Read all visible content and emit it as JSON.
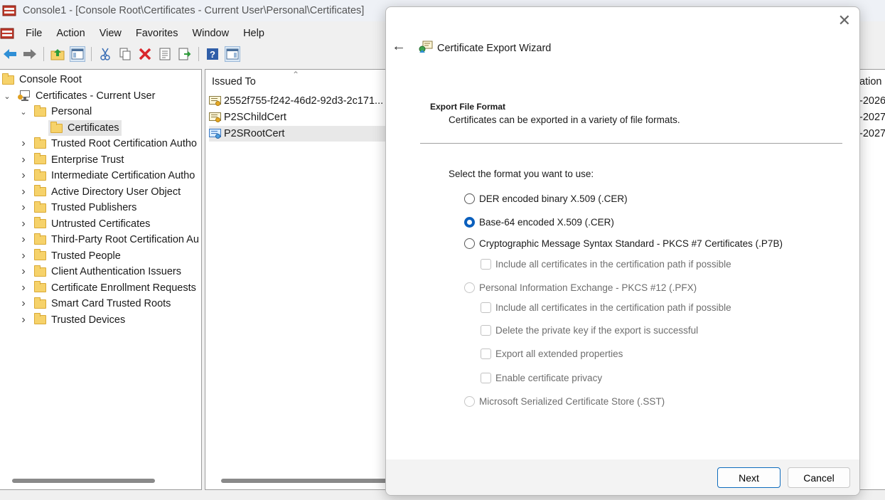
{
  "window": {
    "title": "Console1 - [Console Root\\Certificates - Current User\\Personal\\Certificates]"
  },
  "menu": [
    "File",
    "Action",
    "View",
    "Favorites",
    "Window",
    "Help"
  ],
  "toolbar": {
    "icons": [
      "back-icon",
      "forward-icon",
      "up-folder-icon",
      "show-hide-tree-icon",
      "cut-icon",
      "copy-icon",
      "delete-icon",
      "properties-icon",
      "export-list-icon",
      "help-icon",
      "action-pane-icon"
    ]
  },
  "tree": {
    "root": "Console Root",
    "store": "Certificates - Current User",
    "personal": "Personal",
    "certificates": "Certificates",
    "folders": [
      "Trusted Root Certification Autho",
      "Enterprise Trust",
      "Intermediate Certification Autho",
      "Active Directory User Object",
      "Trusted Publishers",
      "Untrusted Certificates",
      "Third-Party Root Certification Au",
      "Trusted People",
      "Client Authentication Issuers",
      "Certificate Enrollment Requests",
      "Smart Card Trusted Roots",
      "Trusted Devices"
    ]
  },
  "list": {
    "column_issued_to": "Issued To",
    "column_expiration": "ation D",
    "rows": [
      {
        "name": "2552f755-f242-46d2-92d3-2c171...",
        "expiration": "-2026",
        "icon": "certificate-key-icon"
      },
      {
        "name": "P2SChildCert",
        "expiration": "-2027",
        "icon": "certificate-key-icon"
      },
      {
        "name": "P2SRootCert",
        "expiration": "-2027",
        "icon": "certificate-blue-icon"
      }
    ]
  },
  "wizard": {
    "title": "Certificate Export Wizard",
    "section_title": "Export File Format",
    "section_desc": "Certificates can be exported in a variety of file formats.",
    "prompt": "Select the format you want to use:",
    "options": {
      "der": "DER encoded binary X.509 (.CER)",
      "base64": "Base-64 encoded X.509 (.CER)",
      "pkcs7": "Cryptographic Message Syntax Standard - PKCS #7 Certificates (.P7B)",
      "pkcs7_include": "Include all certificates in the certification path if possible",
      "pfx": "Personal Information Exchange - PKCS #12 (.PFX)",
      "pfx_include": "Include all certificates in the certification path if possible",
      "pfx_delete_key": "Delete the private key if the export is successful",
      "pfx_export_props": "Export all extended properties",
      "pfx_privacy": "Enable certificate privacy",
      "sst": "Microsoft Serialized Certificate Store (.SST)"
    },
    "selected_option": "base64",
    "next_label": "Next",
    "cancel_label": "Cancel"
  },
  "colors": {
    "accent": "#0a5fbd",
    "folder": "#f6d26a"
  }
}
